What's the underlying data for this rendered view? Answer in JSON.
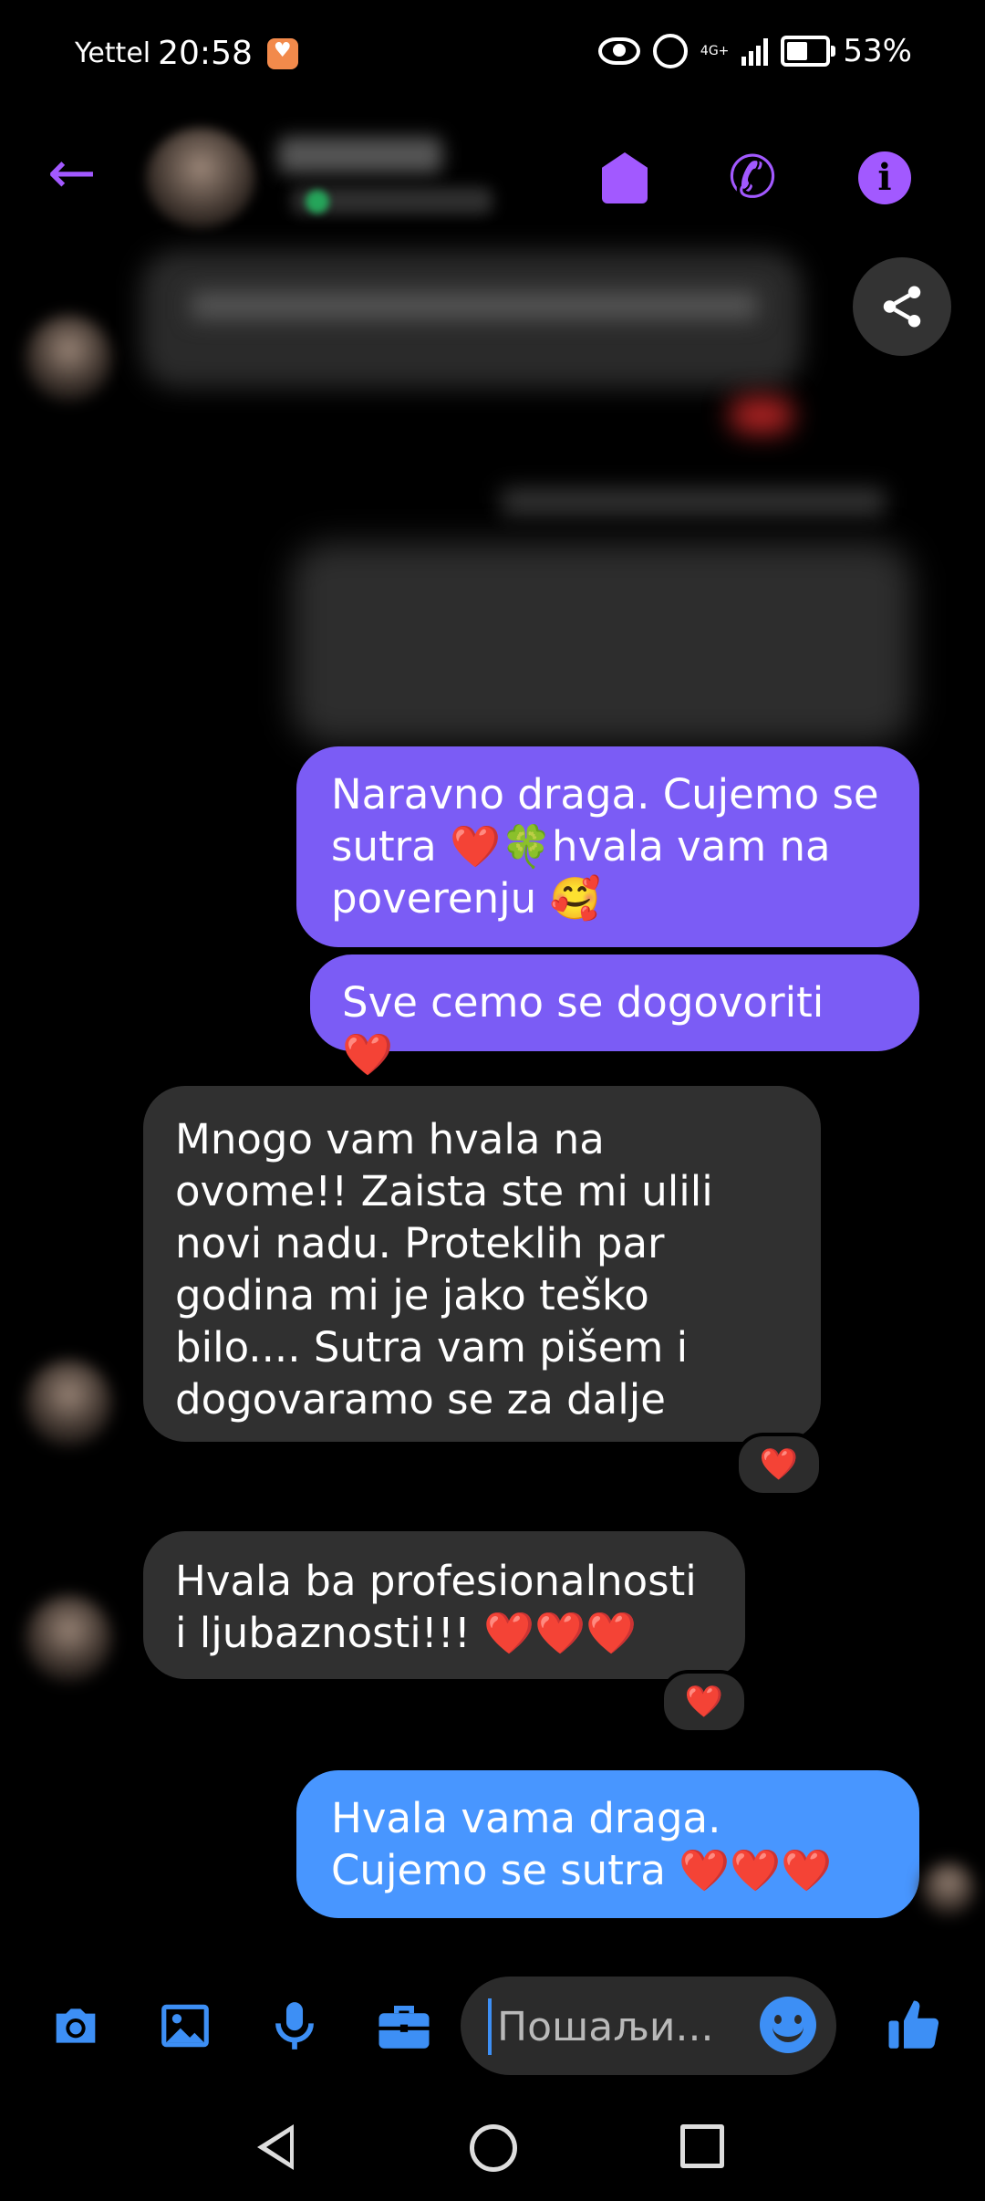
{
  "status_bar": {
    "carrier": "Yettel",
    "time": "20:58",
    "network": "4G+",
    "battery": "53%"
  },
  "header": {
    "icons": [
      "back-arrow-icon",
      "tag-icon",
      "phone-icon",
      "info-icon"
    ]
  },
  "messages": [
    {
      "id": "m1",
      "direction": "outgoing",
      "color": "#7b5cf5",
      "text": "Naravno draga. Cujemo se sutra ❤️🍀hvala vam na poverenju 🥰"
    },
    {
      "id": "m2",
      "direction": "outgoing",
      "color": "#7b5cf5",
      "text": "Sve cemo se dogovoriti ❤️"
    },
    {
      "id": "m3",
      "direction": "incoming",
      "color": "#303030",
      "text": "Mnogo vam hvala na ovome!! Zaista ste mi ulili novi nadu. Proteklih par godina mi je jako teško bilo.... Sutra vam pišem i dogovaramo se za dalje",
      "reaction": "❤️"
    },
    {
      "id": "m4",
      "direction": "incoming",
      "color": "#303030",
      "text": "Hvala ba profesionalnosti i ljubaznosti!!! ❤️❤️❤️",
      "reaction": "❤️"
    },
    {
      "id": "m5",
      "direction": "outgoing",
      "color": "#4896ff",
      "text": "Hvala vama draga. Cujemo se sutra ❤️❤️❤️"
    }
  ],
  "composer": {
    "placeholder": "Пошаљи...",
    "icons": [
      "camera-icon",
      "gallery-icon",
      "microphone-icon",
      "briefcase-icon",
      "emoji-icon",
      "thumbs-up-icon"
    ]
  },
  "colors": {
    "accent_purple": "#a259ff",
    "accent_blue": "#3d8ff5"
  }
}
